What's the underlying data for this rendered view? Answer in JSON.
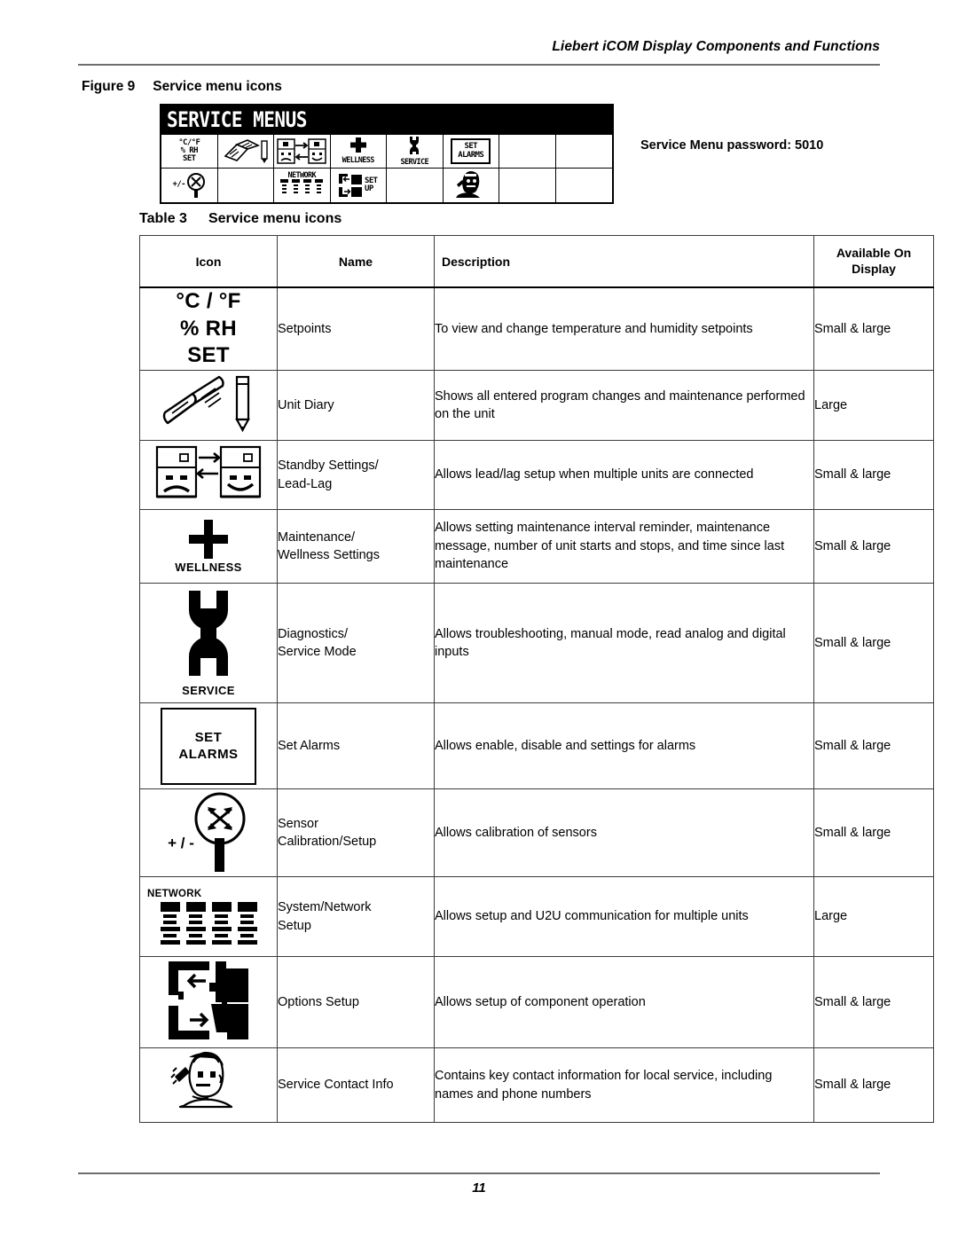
{
  "header": {
    "running_title": "Liebert iCOM Display Components and Functions"
  },
  "figure": {
    "number": "Figure 9",
    "title": "Service menu icons",
    "lcd": {
      "title_bar": "SERVICE MENUS",
      "cells": [
        {
          "id": "setpoints",
          "lines": [
            "°C/°F",
            "% RH",
            "SET"
          ]
        },
        {
          "id": "unit-diary",
          "lines": []
        },
        {
          "id": "standby-leadlag",
          "lines": []
        },
        {
          "id": "wellness",
          "lines": [
            "WELLNESS"
          ]
        },
        {
          "id": "service",
          "lines": [
            "SERVICE"
          ]
        },
        {
          "id": "set-alarms",
          "lines": [
            "SET",
            "ALARMS"
          ]
        },
        {
          "id": "blank-1",
          "lines": []
        },
        {
          "id": "blank-2",
          "lines": []
        },
        {
          "id": "sensor-cal",
          "lines": [
            "+/-"
          ]
        },
        {
          "id": "blank-3",
          "lines": []
        },
        {
          "id": "network",
          "lines": [
            "NETWORK"
          ]
        },
        {
          "id": "options-setup",
          "lines": [
            "SET",
            "UP"
          ]
        },
        {
          "id": "blank-4",
          "lines": []
        },
        {
          "id": "service-contact",
          "lines": []
        },
        {
          "id": "blank-5",
          "lines": []
        },
        {
          "id": "blank-6",
          "lines": []
        }
      ]
    },
    "password_note": "Service Menu password: 5010"
  },
  "table": {
    "number": "Table 3",
    "title": "Service menu icons",
    "columns": {
      "icon": "Icon",
      "name": "Name",
      "description": "Description",
      "available_line1": "Available On",
      "available_line2": "Display"
    },
    "rows": [
      {
        "icon_kind": "setpoints-text",
        "icon_text": {
          "l1": "°C / °F",
          "l2": "% RH",
          "l3": "SET"
        },
        "name": "Setpoints",
        "description": "To view and change temperature and humidity setpoints",
        "available": "Small & large"
      },
      {
        "icon_kind": "diary",
        "name": "Unit Diary",
        "description": "Shows all entered program changes and maintenance performed on the unit",
        "available": "Large"
      },
      {
        "icon_kind": "standby",
        "name": "Standby Settings/ Lead-Lag",
        "name_l1": "Standby Settings/",
        "name_l2": "Lead-Lag",
        "description": "Allows lead/lag setup when multiple units are connected",
        "available": "Small & large"
      },
      {
        "icon_kind": "wellness",
        "icon_label": "WELLNESS",
        "name_l1": "Maintenance/",
        "name_l2": "Wellness Settings",
        "description": "Allows setting maintenance interval reminder, maintenance message, number of unit starts and stops, and time since last maintenance",
        "available": "Small & large"
      },
      {
        "icon_kind": "service-wrench",
        "icon_label": "SERVICE",
        "name_l1": "Diagnostics/",
        "name_l2": "Service Mode",
        "description": "Allows troubleshooting, manual mode, read analog and digital inputs",
        "available": "Small & large"
      },
      {
        "icon_kind": "set-alarms-box",
        "icon_text": {
          "l1": "SET",
          "l2": "ALARMS"
        },
        "name": "Set Alarms",
        "description": "Allows enable, disable and settings for alarms",
        "available": "Small & large"
      },
      {
        "icon_kind": "sensor",
        "icon_label": "+ / -",
        "name_l1": "Sensor",
        "name_l2": "Calibration/Setup",
        "description": "Allows calibration of sensors",
        "available": "Small & large"
      },
      {
        "icon_kind": "network",
        "icon_label": "NETWORK",
        "name_l1": "System/Network",
        "name_l2": "Setup",
        "description": "Allows setup and U2U communication for multiple units",
        "available": "Large"
      },
      {
        "icon_kind": "options",
        "name": "Options Setup",
        "description": "Allows setup of component operation",
        "available": "Small & large"
      },
      {
        "icon_kind": "contact-person",
        "name": "Service Contact Info",
        "description": "Contains key contact information for local service, including names and phone numbers",
        "available": "Small & large"
      }
    ]
  },
  "footer": {
    "page_number": "11"
  }
}
